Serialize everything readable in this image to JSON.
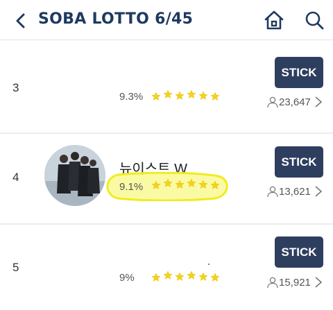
{
  "header": {
    "title": "SOBA LOTTO 6/45",
    "back_icon": "chevron-left-icon",
    "home_icon": "home-icon",
    "search_icon": "search-icon",
    "accent_color": "#1e3a5f"
  },
  "rows": [
    {
      "rank": "3",
      "name": "",
      "percent": "9.3%",
      "stars": 5,
      "stick_label": "STICK",
      "voters": "23,647"
    },
    {
      "rank": "4",
      "name": "뉴이스트 W",
      "percent": "9.1%",
      "stars": 5,
      "stick_label": "STICK",
      "voters": "13,621",
      "has_avatar": true,
      "highlighted": true
    },
    {
      "rank": "5",
      "name": "",
      "percent": "9%",
      "stars": 5,
      "stick_label": "STICK",
      "voters": "15,921"
    }
  ],
  "colors": {
    "stick_button": "#2e3e5f",
    "star": "#f3d21b",
    "highlight": "#f5f03a"
  }
}
